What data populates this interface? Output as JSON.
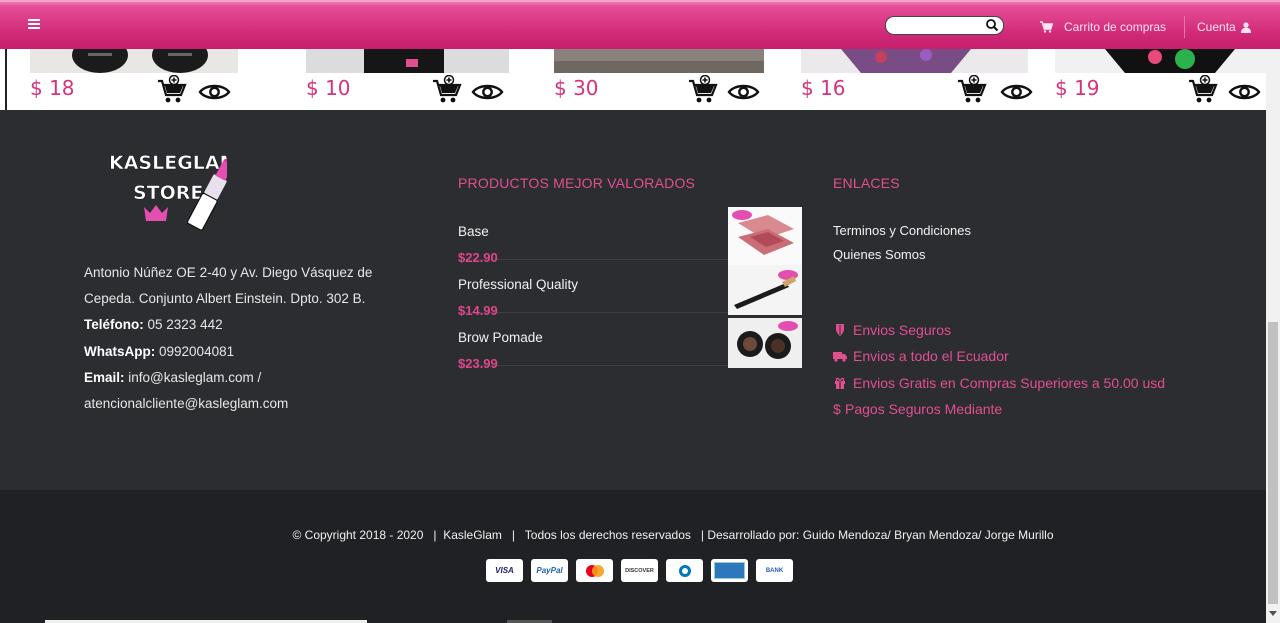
{
  "header": {
    "search_placeholder": "",
    "cart_label": "Carrito de compras",
    "account_label": "Cuenta"
  },
  "products": [
    {
      "price": "$ 18"
    },
    {
      "price": "$ 10"
    },
    {
      "price": "$ 30"
    },
    {
      "price": "$ 16"
    },
    {
      "price": "$ 19"
    }
  ],
  "footer": {
    "logo_text": "KASLEGLAM STORE",
    "address": "Antonio Núñez OE 2-40 y Av. Diego Vásquez de Cepeda. Conjunto Albert Einstein. Dpto. 302 B.",
    "phone_label": "Teléfono:",
    "phone": "05 2323 442",
    "whatsapp_label": "WhatsApp:",
    "whatsapp": "0992004081",
    "email_label": "Email:",
    "email": "info@kasleglam.com /",
    "email2": "atencionalcliente@kasleglam.com",
    "rated_title": "PRODUCTOS MEJOR VALORADOS",
    "rated": [
      {
        "name": "Base",
        "price": "$22.90"
      },
      {
        "name": "Professional Quality",
        "price": "$14.99"
      },
      {
        "name": "Brow Pomade",
        "price": "$23.99"
      }
    ],
    "links_title": "ENLACES",
    "links": [
      "Terminos y Condiciones",
      "Quienes Somos"
    ],
    "features": [
      "Envios Seguros",
      "Envios a todo el Ecuador",
      "Envios Gratis en Compras Superiores a 50.00 usd",
      "Pagos Seguros Mediante"
    ]
  },
  "bottom": {
    "copyright": "© Copyright 2018 - 2020   |  KasleGlam   |   Todos los derechos reservados   | Desarrollado por: Guido Mendoza/ Bryan Mendoza/ Jorge Murillo",
    "cards": [
      "VISA",
      "PayPal",
      "mastercard",
      "DISCOVER",
      "Diners",
      "AMEX",
      "BANK"
    ]
  },
  "colors": {
    "brand": "#d22b79",
    "accent": "#e24f8f",
    "footer_bg": "#2b2d31",
    "bottom_bg": "#202125"
  }
}
